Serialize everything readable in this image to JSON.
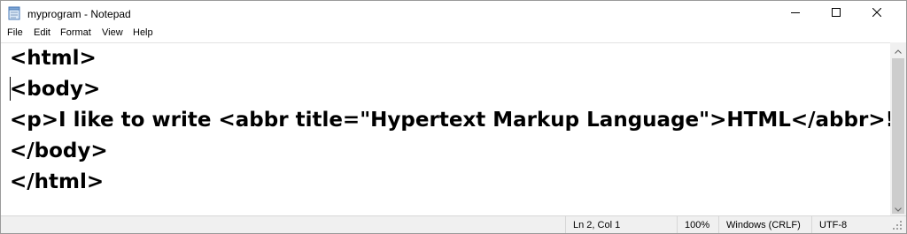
{
  "window": {
    "title": "myprogram - Notepad",
    "icon": "notepad-icon"
  },
  "menu": {
    "items": [
      "File",
      "Edit",
      "Format",
      "View",
      "Help"
    ]
  },
  "editor": {
    "lines": [
      "<html>",
      "<body>",
      "<p>I like to write <abbr title=\"Hypertext Markup Language\">HTML</abbr>!</p>",
      "</body>",
      "</html>"
    ]
  },
  "status": {
    "position": "Ln 2, Col 1",
    "zoom": "100%",
    "line_ending": "Windows (CRLF)",
    "encoding": "UTF-8"
  }
}
